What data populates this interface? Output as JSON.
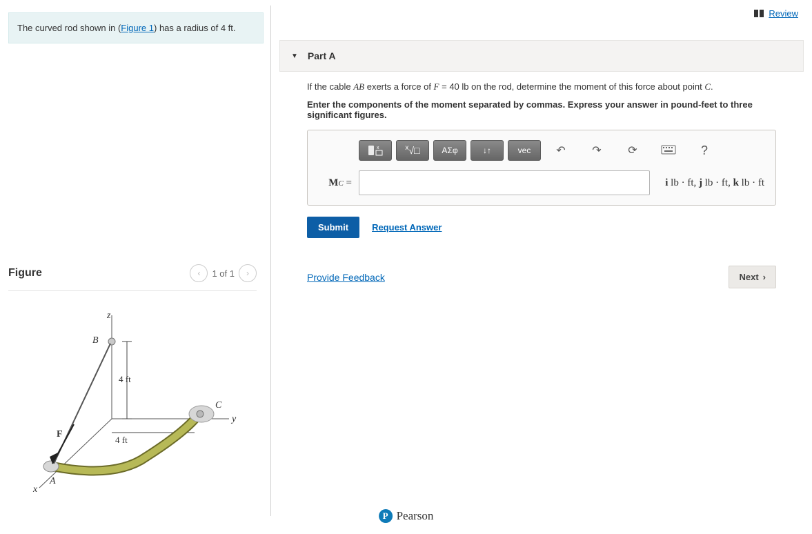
{
  "review": {
    "label": "Review"
  },
  "intro": {
    "before_link": "The curved rod shown in (",
    "link_text": "Figure 1",
    "after_link": ") has a radius of 4 ft."
  },
  "figure": {
    "title": "Figure",
    "page_indicator": "1 of 1",
    "labels": {
      "z": "z",
      "y": "y",
      "x": "x",
      "A": "A",
      "B": "B",
      "C": "C",
      "F": "F",
      "dim_v": "4 ft",
      "dim_h": "4 ft"
    }
  },
  "part": {
    "title": "Part A",
    "question_before": "If the cable ",
    "cable": "AB",
    "question_mid": " exerts a force of ",
    "force_sym": "F",
    "force_eq": " = 40 lb",
    "question_after": " on the rod, determine the moment of this force about point ",
    "point": "C",
    "period": ".",
    "instruction": "Enter the components of the moment separated by commas. Express your answer in pound-feet to three significant figures."
  },
  "toolbar": {
    "sqrt": "√",
    "greek": "ΑΣφ",
    "arrows": "↓↑",
    "vec": "vec",
    "undo": "↶",
    "redo": "↷",
    "reset": "⟳",
    "keyboard": "⌨",
    "help": "?"
  },
  "answer": {
    "label_main": "M",
    "label_sub": "C",
    "label_eq": " =",
    "value": "",
    "units": "i lb · ft, j lb · ft, k lb · ft"
  },
  "buttons": {
    "submit": "Submit",
    "request": "Request Answer",
    "feedback": "Provide Feedback",
    "next": "Next"
  },
  "brand": {
    "name": "Pearson",
    "initial": "P"
  }
}
